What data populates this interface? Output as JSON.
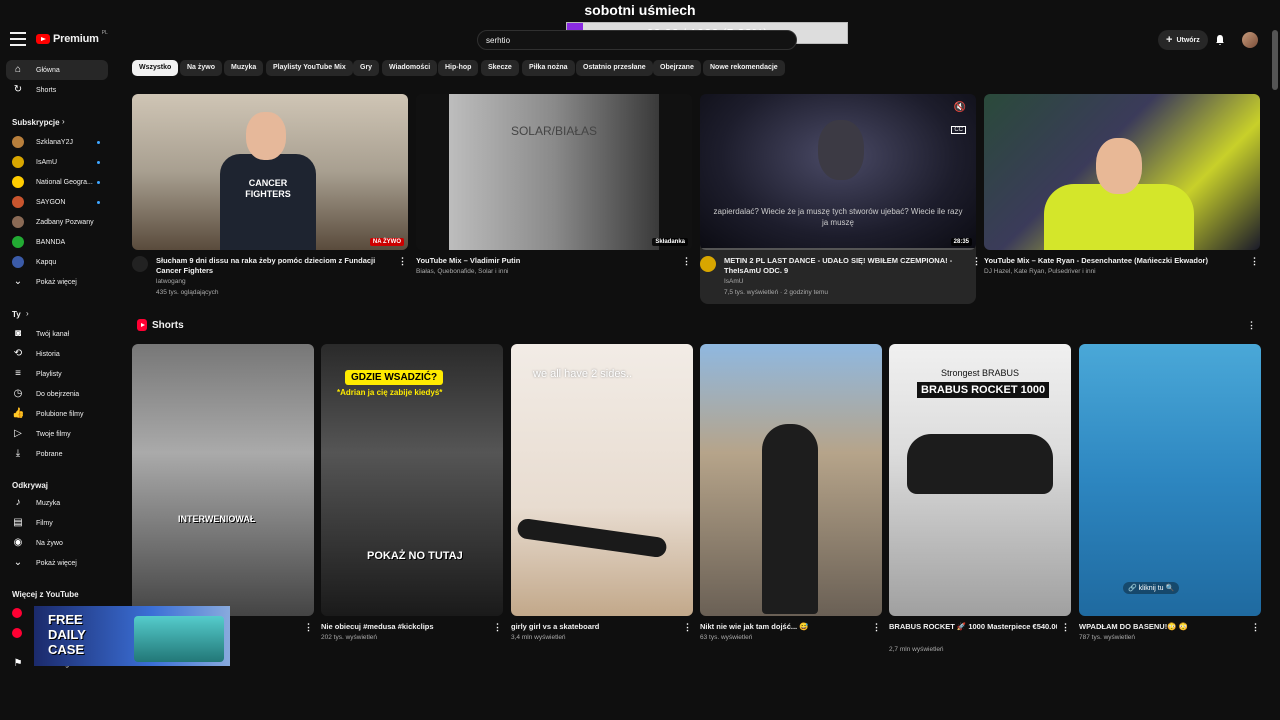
{
  "overlay": {
    "title": "sobotni uśmiech",
    "progress_text": "60.00 / 1020 (5.88%)",
    "progress_fraction": 0.0588
  },
  "header": {
    "logo": "Premium",
    "logo_region": "PL",
    "search_value": "serhtio",
    "create_label": "Utwórz"
  },
  "sidebar": {
    "main": [
      {
        "label": "Główna",
        "icon": "home-icon"
      },
      {
        "label": "Shorts",
        "icon": "shorts-icon"
      }
    ],
    "subs_title": "Subskrypcje",
    "subs": [
      {
        "label": "SzklanaY2J",
        "color": "#b87f3c"
      },
      {
        "label": "IsAmU",
        "color": "#d8a600"
      },
      {
        "label": "National Geogra...",
        "color": "#ffcc00"
      },
      {
        "label": "SAYGON",
        "color": "#c8552e"
      },
      {
        "label": "Zadbany Pozwany",
        "color": "#8a6a55"
      },
      {
        "label": "BANNDA",
        "color": "#22aa33"
      },
      {
        "label": "Kapqu",
        "color": "#3b5ba8"
      }
    ],
    "show_more": "Pokaż więcej",
    "you_title": "Ty",
    "you": [
      {
        "label": "Twój kanał"
      },
      {
        "label": "Historia"
      },
      {
        "label": "Playlisty"
      },
      {
        "label": "Do obejrzenia"
      },
      {
        "label": "Polubione filmy"
      },
      {
        "label": "Twoje filmy"
      },
      {
        "label": "Pobrane"
      }
    ],
    "explore_title": "Odkrywaj",
    "explore": [
      {
        "label": "Muzyka"
      },
      {
        "label": "Filmy"
      },
      {
        "label": "Na żywo"
      },
      {
        "label": "Pokaż więcej"
      }
    ],
    "more_title": "Więcej z YouTube",
    "bottom": "Historia zgłoszeń"
  },
  "chips": [
    "Wszystko",
    "Na żywo",
    "Muzyka",
    "Playlisty YouTube Mix",
    "Gry",
    "Wiadomości",
    "Hip-hop",
    "Skecze",
    "Piłka nożna",
    "Ostatnio przesłane",
    "Obejrzane",
    "Nowe rekomendacje"
  ],
  "videos": [
    {
      "title": "Słucham 9 dni dissu na raka żeby pomóc dzieciom z Fundacji Cancer Fighters",
      "channel": "latwogang",
      "meta": "435 tys. oglądających",
      "badge": "NA ŻYWO",
      "shirt_text": "CANCER FIGHTERS"
    },
    {
      "title": "YouTube Mix – Vladimir Putin",
      "channel": "Białas, Quebonafide, Solar i inni",
      "meta": "",
      "badge": "Składanka",
      "thumb_text": "SOLAR/BIAŁAS"
    },
    {
      "title": "METIN 2 PL LAST DANCE - UDAŁO SIĘ! WBIŁEM CZEMPIONA! - TheIsAmU ODC. 9",
      "channel": "IsAmU",
      "meta": "7,5 tys. wyświetleń · 2 godziny temu",
      "badge": "28:35",
      "subtitle": "zapierdalać? Wiecie że ja muszę tych stworów ujebać? Wiecie ile razy ja muszę"
    },
    {
      "title": "YouTube Mix – Kate Ryan - Desenchantee (Mańieczki Ekwador)",
      "channel": "DJ Hazel, Kate Ryan, Pulsedriver i inni",
      "meta": "",
      "badge": ""
    }
  ],
  "shorts_title": "Shorts",
  "shorts": [
    {
      "title": "...tura bada śmierć",
      "views": "",
      "views2": "",
      "caption": "INTERWENIOWAŁ"
    },
    {
      "title": "Nie obiecuj #medusa #kickclips",
      "views": "202 tys. wyświetleń",
      "views2": "",
      "caption": "GDZIE WSADZIĆ?",
      "caption2": "*Adrian ja cię zabije kiedyś*",
      "caption3": "POKAŻ NO TUTAJ"
    },
    {
      "title": "girly girl vs a skateboard",
      "views": "3,4 mln wyświetleń",
      "views2": "",
      "caption": "we all have 2 sides.."
    },
    {
      "title": "Nikt nie wie jak tam dojść... 😅",
      "views": "63 tys. wyświetleń",
      "views2": "",
      "caption": ""
    },
    {
      "title": "BRABUS ROCKET 🚀 1000 Masterpiece €540.000",
      "views": "",
      "views2": "2,7 mln wyświetleń",
      "caption": "Strongest BRABUS",
      "caption2": "BRABUS ROCKET 1000"
    },
    {
      "title": "WPADŁAM DO BASENU!😳 😳",
      "views": "787 tys. wyświetleń",
      "views2": "",
      "caption": "🔗 kliknij tu 🔍"
    }
  ],
  "ad": {
    "text": "FREE DAILY CASE"
  }
}
